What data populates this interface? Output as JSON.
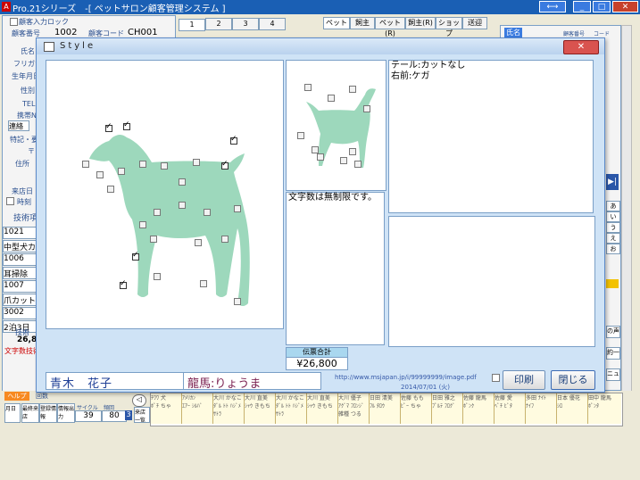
{
  "window": {
    "title": "Pro.21シリーズ　-[ ペットサロン顧客管理システム ]",
    "app_icon": "A"
  },
  "titlebar_buttons": {
    "resize": "⟷",
    "minimize": "_",
    "maximize": "□",
    "close": "✕"
  },
  "background": {
    "top_checkbox_label": "顧客入力ロック",
    "customer_no_label": "顧客番号",
    "customer_no": "1002",
    "customer_code_label": "顧客コード",
    "customer_code": "CH001",
    "name_label": "氏名",
    "furigana_label": "フリガナ",
    "birthday_label": "生年月日",
    "gender_label": "性別",
    "tel_label": "TEL",
    "mobile_label": "携帯№",
    "contact_label": "連絡",
    "special_label": "特記・要",
    "zip_label": "〒",
    "address_label": "住所",
    "visit_date_label": "来店日",
    "time_label": "時刻",
    "tech_label": "技術項",
    "services": [
      "1021",
      "中型犬カ",
      "1006",
      "耳掃除",
      "1007",
      "爪カット",
      "3002",
      "2泊3日"
    ],
    "tech_section_label": "技術",
    "tech_total": "26,80",
    "bg_warning": "文字数技術",
    "page_tabs": [
      "1",
      "2",
      "3",
      "4"
    ],
    "pet_tabs": [
      "ペット",
      "飼主",
      "ペット(R)",
      "飼主(R)",
      "ショップ",
      "送迎"
    ],
    "right_label": "氏名",
    "right_small": [
      "顧客番号",
      "コード"
    ],
    "right_side": [
      "あ",
      "い",
      "う",
      "え",
      "お"
    ],
    "bottom_left_labels": [
      "ヘルプ",
      "月日",
      "最終来店",
      "登録情報",
      "情報出力"
    ],
    "bottom_left_top": "回数",
    "cycle_label": "サイクル",
    "cycle_value": "39",
    "frequency_label": "頻回",
    "frequency_value": "80",
    "page_num": "3",
    "extra_btn": "来店一覧",
    "right_menu": [
      "の声",
      "約一覧",
      "ニュー"
    ],
    "pet_list": [
      {
        "kana": "ﾁﾜﾜ 犬",
        "name": "ﾎﾟﾁ ちゃ"
      },
      {
        "kana": "ｱﾒﾘｶﾝ",
        "name": "ｴｱｰ ｼﾙﾊﾞ"
      },
      {
        "kana": "大川 かなこ",
        "name": "ﾀﾞﾙ ﾄﾄ ﾊｼﾞﾒ ｻﾄﾗ"
      },
      {
        "kana": "大川 直美",
        "name": "ｼｬｳ きもち"
      },
      {
        "kana": "大川 かなこ",
        "name": "ﾀﾞﾙ ﾄﾄ ﾊｼﾞﾒ ｻﾄﾗ"
      },
      {
        "kana": "大川 直美",
        "name": "ｼｬｳ きもち"
      },
      {
        "kana": "大川 優子",
        "name": "ｱｸﾞﾏ ﾌﾛﾝｼﾞ 雑種 つる"
      },
      {
        "kana": "日田 清美",
        "name": "ﾌﾙ ﾀﾛｳ"
      },
      {
        "kana": "佐藤 もも",
        "name": "ﾋﾟｰ ちゃ"
      },
      {
        "kana": "日田 雅之",
        "name": "ﾌﾟﾙﾃ ﾌﾛｸﾞ"
      },
      {
        "kana": "佐藤 龍馬",
        "name": "ﾎﾟﾝｸ"
      },
      {
        "kana": "佐藤 愛",
        "name": "ﾍﾟﾁ ﾋﾞﾀ"
      },
      {
        "kana": "多田 ﾅｲﾄ",
        "name": "ﾅｲﾌ"
      },
      {
        "kana": "日本 優花",
        "name": "ｼﾛ"
      },
      {
        "kana": "田中 龍馬",
        "name": "ﾎﾟﾝﾀ"
      }
    ]
  },
  "dialog": {
    "title": "Style",
    "close_label": "✕",
    "note_top": [
      "テール:カットなし",
      "右前:ケガ"
    ],
    "note_middle": "文字数は無制限です。",
    "total_label": "伝票合計",
    "total_value": "¥26,800",
    "customer_name": "青木　花子",
    "pet_name": "龍馬:りょうま",
    "url": "http://www.msjapan.jp/i/99999999/image.pdf",
    "date": "2014/07/01 (火)",
    "print_label": "印刷",
    "close_button_label": "閉じる"
  },
  "colors": {
    "title_bar": "#1a5fb4",
    "silhouette": "#9dd8bc",
    "name_text": "#1f3f96",
    "pet_text": "#7a1f4f",
    "total_label_bg": "#a9d7ef"
  }
}
